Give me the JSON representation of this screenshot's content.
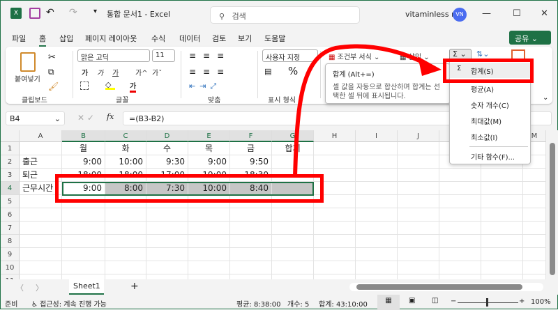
{
  "titlebar": {
    "title": "통합 문서1  -  Excel",
    "search_placeholder": "검색",
    "user_name": "vitaminless n",
    "avatar_initials": "VN",
    "minimize": "—",
    "maximize": "☐",
    "close": "✕"
  },
  "menu": {
    "items": [
      "파일",
      "홈",
      "삽입",
      "페이지 레이아웃",
      "수식",
      "데이터",
      "검토",
      "보기",
      "도움말"
    ],
    "share": "공유"
  },
  "ribbon": {
    "paste": "붙여넣기",
    "clipboard": "클립보드",
    "font_name": "맑은 고딕",
    "font_size": "11",
    "bold": "가",
    "italic": "가",
    "underline": "가",
    "grow": "가^",
    "shrink": "가ˇ",
    "font_group": "글꼴",
    "font_color": "가",
    "align_group": "맞춤",
    "number_format": "사용자 지정",
    "percent": "%",
    "number_group": "표시 형식",
    "conditional": "조건부 서식",
    "insert": "삽입",
    "sigma": "Σ"
  },
  "formula_bar": {
    "name_box": "B4",
    "fx": "fx",
    "formula": "=(B3-B2)"
  },
  "sheet": {
    "columns": [
      "A",
      "B",
      "C",
      "D",
      "E",
      "F",
      "G",
      "H",
      "I",
      "J",
      "K",
      "L",
      "M"
    ],
    "rows": [
      "1",
      "2",
      "3",
      "4",
      "5",
      "6",
      "7",
      "8",
      "9",
      "10",
      "11"
    ],
    "cells": [
      [
        "",
        "월",
        "화",
        "수",
        "목",
        "금",
        "합계"
      ],
      [
        "출근",
        "9:00",
        "10:00",
        "9:30",
        "9:00",
        "9:50",
        ""
      ],
      [
        "퇴근",
        "18:00",
        "18:00",
        "17:00",
        "19:00",
        "18:30",
        ""
      ],
      [
        "근무시간",
        "9:00",
        "8:00",
        "7:30",
        "10:00",
        "8:40",
        ""
      ]
    ]
  },
  "tooltip": {
    "title": "합계 (Alt+=)",
    "body": "셀 값을 자동으로 합산하며 합계는 선택한 셀 뒤에 표시됩니다."
  },
  "autosum_menu": [
    "합계(S)",
    "평균(A)",
    "숫자 개수(C)",
    "최대값(M)",
    "최소값(I)",
    "기타 함수(F)..."
  ],
  "tabs": {
    "sheet": "Sheet1",
    "add": "+"
  },
  "status": {
    "ready": "준비",
    "accessibility": "접근성: 계속 진행 가능",
    "average": "평균: 8:38:00",
    "count": "개수: 5",
    "sum": "합계: 43:10:00",
    "zoom": "100%"
  },
  "colors": {
    "accent": "#1e7145",
    "highlight": "#ff0000"
  }
}
